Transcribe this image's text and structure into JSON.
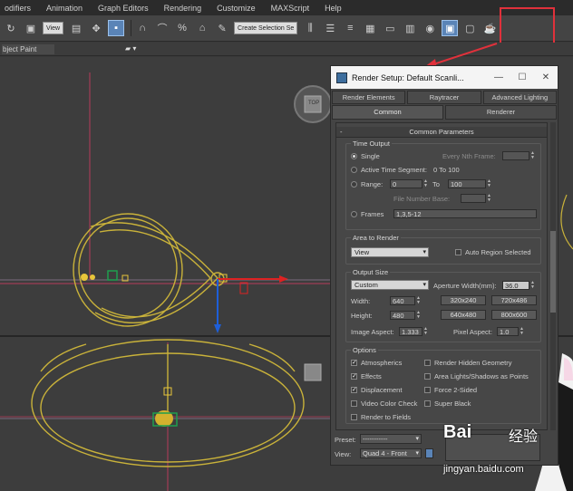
{
  "menu": [
    "odifiers",
    "Animation",
    "Graph Editors",
    "Rendering",
    "Customize",
    "MAXScript",
    "Help"
  ],
  "toolbar": {
    "view_select": "View",
    "selection_set": "Create Selection Se"
  },
  "ribbon": {
    "label": "bject Paint"
  },
  "viewport": {
    "nav_cube_label": "TOP"
  },
  "dialog": {
    "title": "Render Setup: Default Scanli...",
    "window_buttons": {
      "minimize": "—",
      "maximize": "☐",
      "close": "✕"
    },
    "tabs_row1": [
      "Render Elements",
      "Raytracer",
      "Advanced Lighting"
    ],
    "tabs_row2": [
      "Common",
      "Renderer"
    ],
    "rollout_title": "Common Parameters",
    "time_output": {
      "title": "Time Output",
      "single": "Single",
      "every_nth_frame": "Every Nth Frame:",
      "active_time_segment": "Active Time Segment:",
      "active_time_value": "0 To 100",
      "range": "Range:",
      "range_from": "0",
      "range_to_label": "To",
      "range_to": "100",
      "file_number_base": "File Number Base:",
      "frames": "Frames",
      "frames_value": "1,3,5-12"
    },
    "area_to_render": {
      "title": "Area to Render",
      "selected": "View",
      "auto_region": "Auto Region Selected"
    },
    "output_size": {
      "title": "Output Size",
      "preset": "Custom",
      "aperture_label": "Aperture Width(mm):",
      "aperture_value": "36.0",
      "width_label": "Width:",
      "width_value": "640",
      "height_label": "Height:",
      "height_value": "480",
      "presets": [
        "320x240",
        "720x486",
        "640x480",
        "800x600"
      ],
      "image_aspect_label": "Image Aspect:",
      "image_aspect_value": "1.333",
      "pixel_aspect_label": "Pixel Aspect:",
      "pixel_aspect_value": "1.0"
    },
    "options": {
      "title": "Options",
      "left": [
        {
          "label": "Atmospherics",
          "checked": true
        },
        {
          "label": "Effects",
          "checked": true
        },
        {
          "label": "Displacement",
          "checked": true
        },
        {
          "label": "Video Color Check",
          "checked": false
        },
        {
          "label": "Render to Fields",
          "checked": false
        }
      ],
      "right": [
        {
          "label": "Render Hidden Geometry",
          "checked": false
        },
        {
          "label": "Area Lights/Shadows as Points",
          "checked": false
        },
        {
          "label": "Force 2-Sided",
          "checked": false
        },
        {
          "label": "Super Black",
          "checked": false
        }
      ]
    },
    "footer": {
      "preset_label": "Preset:",
      "preset_value": "-----------",
      "view_label": "View:",
      "view_value": "Quad 4 - Front"
    }
  },
  "watermark": {
    "logo": "Bai",
    "cn": "经验",
    "url": "jingyan.baidu.com"
  },
  "colors": {
    "highlight": "#e0313b",
    "accent": "#5a84b7",
    "wire": "#c9b23a"
  }
}
